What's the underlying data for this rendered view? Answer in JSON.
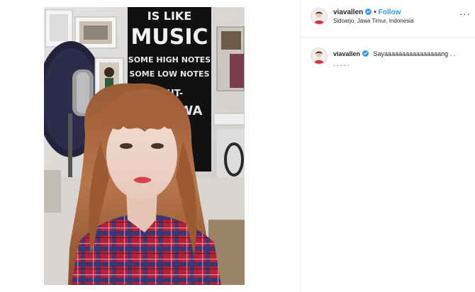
{
  "post": {
    "username": "viavallen",
    "verified": true,
    "follow_label": "Follow",
    "location": "Sidoarjo, Jawa Timur, Indonesia",
    "more_icon": "more-options-icon"
  },
  "photo": {
    "poster_text": [
      "IS LIKE",
      "MUSIC",
      "SOME HIGH NOTES",
      "SOME LOW NOTES",
      "-BUT-",
      "ALWA"
    ]
  },
  "caption": {
    "username": "viavallen",
    "text": "Sayaaaaaaaaaaaaaaaang . .",
    "text_line2": ". . . . ."
  },
  "colors": {
    "link_blue": "#3897f0",
    "text_dark": "#262626",
    "divider": "#efefef"
  }
}
